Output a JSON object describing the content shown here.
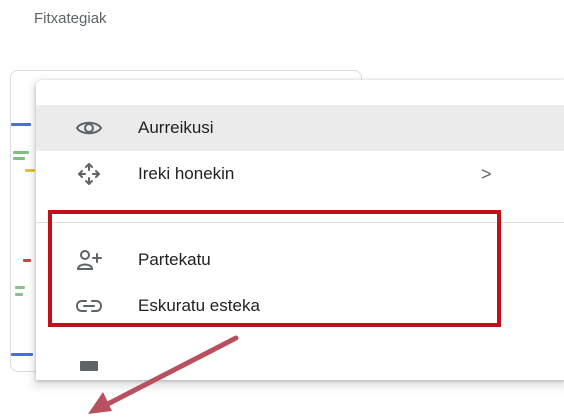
{
  "page": {
    "section_title": "Fitxategiak"
  },
  "context_menu": {
    "items": [
      {
        "label": "Aurreikusi",
        "icon": "eye-icon",
        "hovered": true
      },
      {
        "label": "Ireki honekin",
        "icon": "move-arrows-icon",
        "submenu_indicator": ">"
      },
      {
        "label": "Partekatu",
        "icon": "add-person-icon"
      },
      {
        "label": "Eskuratu esteka",
        "icon": "link-icon"
      }
    ]
  },
  "annotations": {
    "highlight_color": "#c0101a",
    "arrow_color": "#b8505e"
  }
}
